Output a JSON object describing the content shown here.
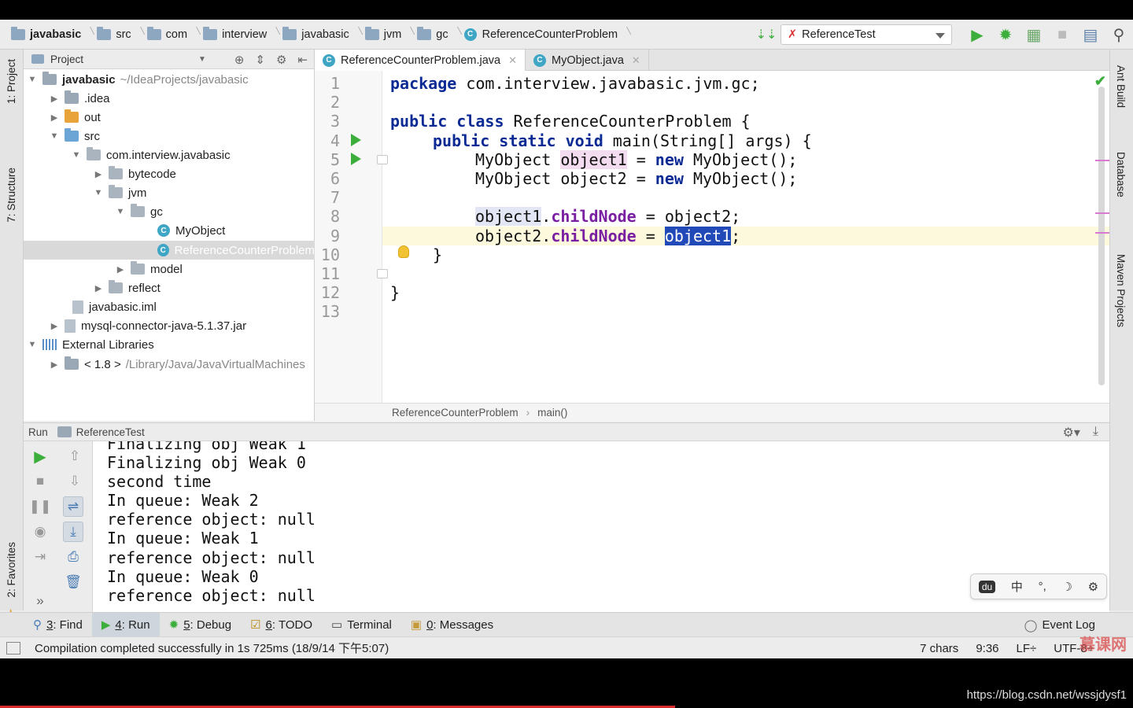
{
  "breadcrumbs": [
    "javabasic",
    "src",
    "com",
    "interview",
    "javabasic",
    "jvm",
    "gc",
    "ReferenceCounterProblem"
  ],
  "run_config": "ReferenceTest",
  "left_tools": [
    "1: Project",
    "7: Structure",
    "2: Favorites"
  ],
  "right_tools": [
    "Ant Build",
    "Database",
    "Maven Projects"
  ],
  "project": {
    "title": "Project",
    "tree": [
      {
        "label": "javabasic",
        "extra": "~/IdeaProjects/javabasic"
      },
      {
        "label": ".idea"
      },
      {
        "label": "out"
      },
      {
        "label": "src"
      },
      {
        "label": "com.interview.javabasic"
      },
      {
        "label": "bytecode"
      },
      {
        "label": "jvm"
      },
      {
        "label": "gc"
      },
      {
        "label": "MyObject"
      },
      {
        "label": "ReferenceCounterProblem"
      },
      {
        "label": "model"
      },
      {
        "label": "reflect"
      },
      {
        "label": "javabasic.iml"
      },
      {
        "label": "mysql-connector-java-5.1.37.jar"
      },
      {
        "label": "External Libraries"
      },
      {
        "label": "< 1.8 >",
        "extra": "/Library/Java/JavaVirtualMachines"
      }
    ]
  },
  "tabs": [
    {
      "label": "ReferenceCounterProblem.java",
      "icon": "C"
    },
    {
      "label": "MyObject.java",
      "icon": "C"
    }
  ],
  "editor": {
    "line_numbers": [
      "1",
      "2",
      "3",
      "4",
      "5",
      "6",
      "7",
      "8",
      "9",
      "10",
      "11",
      "12",
      "13"
    ],
    "code": {
      "l1_kw": "package",
      "l1_rest": " com.interview.javabasic.jvm.gc;",
      "l3_kw": "public class",
      "l3_rest": " ReferenceCounterProblem {",
      "l4_kw": "public static void",
      "l4_rest": " main(String[] args) {",
      "l5_type": "MyObject ",
      "l5_var": "object1",
      "l5_eq": " = ",
      "l5_new": "new",
      "l5_rest": " MyObject();",
      "l6_type": "MyObject object2 = ",
      "l6_new": "new",
      "l6_rest": " MyObject();",
      "l8_var": "object1",
      "l8_dot": ".",
      "l8_fld": "childNode",
      "l8_rest": " = object2;",
      "l9_var": "object2",
      "l9_dot": ".",
      "l9_fld": "childNode",
      "l9_eq": " = ",
      "l9_sel": "object1",
      "l9_end": ";",
      "l10": "}",
      "l12": "}"
    },
    "breadcrumb_class": "ReferenceCounterProblem",
    "breadcrumb_method": "main()"
  },
  "run": {
    "label": "Run",
    "config": "ReferenceTest",
    "output": [
      "Finalizing obj Weak 1",
      "Finalizing obj Weak 0",
      "second time",
      "In queue: Weak 2",
      "reference object: null",
      "In queue: Weak 1",
      "reference object: null",
      "In queue: Weak 0",
      "reference object: null"
    ]
  },
  "ime": [
    "du",
    "中",
    "°,",
    "☽",
    "⚙"
  ],
  "tool_windows": [
    {
      "num": "3",
      "label": ": Find"
    },
    {
      "num": "4",
      "label": ": Run"
    },
    {
      "num": "5",
      "label": ": Debug"
    },
    {
      "num": "6",
      "label": ": TODO"
    },
    {
      "num": "",
      "label": "Terminal"
    },
    {
      "num": "0",
      "label": ": Messages"
    }
  ],
  "event_log": "Event Log",
  "status": {
    "message": "Compilation completed successfully in 1s 725ms (18/9/14 下午5:07)",
    "chars": "7 chars",
    "position": "9:36",
    "line_sep": "LF÷",
    "encoding": "UTF-8÷"
  },
  "watermark": "https://blog.csdn.net/wssjdysf1",
  "brand": "慕课网",
  "colors": {
    "keyword": "#0b2a93",
    "field": "#7a1fa2",
    "run_green": "#3cae3c",
    "selection": "#2149b7"
  }
}
